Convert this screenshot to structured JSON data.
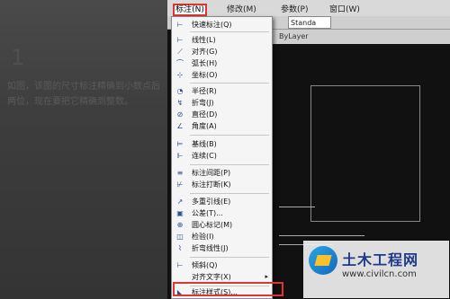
{
  "left_panel": {
    "step_number": "1",
    "description": "如图，该图的尺寸标注精确到小数点后两位，现在要把它精确到整数。"
  },
  "menubar": {
    "items": [
      {
        "label": "标注(N)"
      },
      {
        "label": "修改(M)"
      },
      {
        "label": "参数(P)"
      },
      {
        "label": "窗口(W)"
      }
    ]
  },
  "toolbar": {
    "standard": "Standa",
    "layer": "ByLayer"
  },
  "dropdown": {
    "items": [
      {
        "label": "快速标注(Q)",
        "icon": "quick-dim-icon",
        "glyph": "⊢"
      },
      {
        "label": "线性(L)",
        "icon": "linear-icon",
        "glyph": "⊢"
      },
      {
        "label": "对齐(G)",
        "icon": "aligned-icon",
        "glyph": "⟋"
      },
      {
        "label": "弧长(H)",
        "icon": "arc-length-icon",
        "glyph": "⌒"
      },
      {
        "label": "坐标(O)",
        "icon": "ordinate-icon",
        "glyph": "⊹"
      },
      {
        "label": "半径(R)",
        "icon": "radius-icon",
        "glyph": "◔"
      },
      {
        "label": "折弯(J)",
        "icon": "jogged-icon",
        "glyph": "↯"
      },
      {
        "label": "直径(D)",
        "icon": "diameter-icon",
        "glyph": "⊘"
      },
      {
        "label": "角度(A)",
        "icon": "angular-icon",
        "glyph": "∠"
      },
      {
        "label": "基线(B)",
        "icon": "baseline-icon",
        "glyph": "⊨"
      },
      {
        "label": "连续(C)",
        "icon": "continue-icon",
        "glyph": "⊩"
      },
      {
        "label": "标注间距(P)",
        "icon": "dim-space-icon",
        "glyph": "≡"
      },
      {
        "label": "标注打断(K)",
        "icon": "dim-break-icon",
        "glyph": "⊬"
      },
      {
        "label": "多重引线(E)",
        "icon": "multileader-icon",
        "glyph": "↗"
      },
      {
        "label": "公差(T)...",
        "icon": "tolerance-icon",
        "glyph": "▣"
      },
      {
        "label": "圆心标记(M)",
        "icon": "center-mark-icon",
        "glyph": "⊕"
      },
      {
        "label": "检验(I)",
        "icon": "inspect-icon",
        "glyph": "◫"
      },
      {
        "label": "折弯线性(J)",
        "icon": "jogged-linear-icon",
        "glyph": "⌇"
      },
      {
        "label": "倾斜(Q)",
        "icon": "oblique-icon",
        "glyph": "⊢"
      },
      {
        "label": "对齐文字(X)",
        "icon": "align-text-icon",
        "glyph": ""
      },
      {
        "label": "标注样式(S)...",
        "icon": "dim-style-icon",
        "glyph": "◣"
      }
    ]
  },
  "watermark": {
    "name": "土木工程网",
    "url": "www.civilcn.com"
  }
}
